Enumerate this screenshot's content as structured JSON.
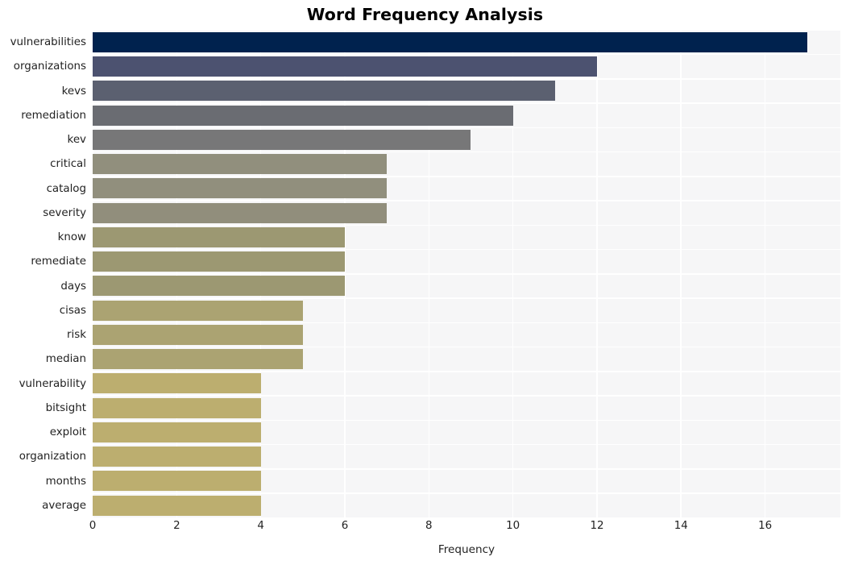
{
  "chart_data": {
    "type": "bar",
    "orientation": "horizontal",
    "title": "Word Frequency Analysis",
    "xlabel": "Frequency",
    "ylabel": "",
    "categories": [
      "vulnerabilities",
      "organizations",
      "kevs",
      "remediation",
      "kev",
      "critical",
      "catalog",
      "severity",
      "know",
      "remediate",
      "days",
      "cisas",
      "risk",
      "median",
      "vulnerability",
      "bitsight",
      "exploit",
      "organization",
      "months",
      "average"
    ],
    "values": [
      17,
      12,
      11,
      10,
      9,
      7,
      7,
      7,
      6,
      6,
      6,
      5,
      5,
      5,
      4,
      4,
      4,
      4,
      4,
      4
    ],
    "bar_colors": [
      "#00224e",
      "#4c5270",
      "#5b6070",
      "#6a6c72",
      "#777778",
      "#918f7d",
      "#918f7d",
      "#918e7c",
      "#9c9872",
      "#9c9872",
      "#9c9872",
      "#aba372",
      "#aba372",
      "#aba372",
      "#bcae6f",
      "#bcae6f",
      "#bcae6f",
      "#bcae6f",
      "#bcae6f",
      "#bcae6f"
    ],
    "xlim": [
      0,
      17.79
    ],
    "xticks": [
      0,
      2,
      4,
      6,
      8,
      10,
      12,
      14,
      16
    ],
    "xticklabels": [
      "0",
      "2",
      "4",
      "6",
      "8",
      "10",
      "12",
      "14",
      "16"
    ],
    "grid": true,
    "grid_axis": "both",
    "grid_color": "#ffffff",
    "plot_background": "#f6f6f7",
    "figure_background": "#ffffff",
    "legend": null
  }
}
